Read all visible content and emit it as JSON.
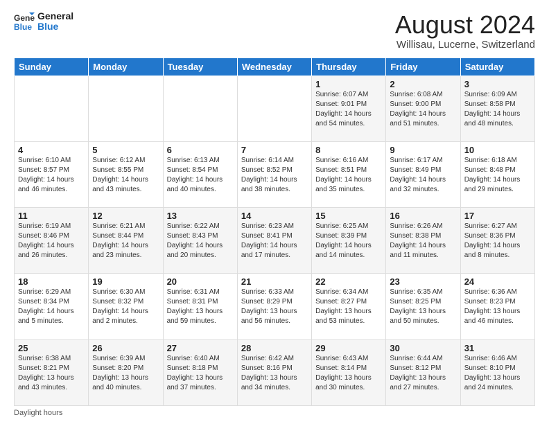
{
  "logo": {
    "line1": "General",
    "line2": "Blue"
  },
  "header": {
    "month": "August 2024",
    "location": "Willisau, Lucerne, Switzerland"
  },
  "weekdays": [
    "Sunday",
    "Monday",
    "Tuesday",
    "Wednesday",
    "Thursday",
    "Friday",
    "Saturday"
  ],
  "footer": "Daylight hours",
  "weeks": [
    [
      {
        "day": "",
        "info": ""
      },
      {
        "day": "",
        "info": ""
      },
      {
        "day": "",
        "info": ""
      },
      {
        "day": "",
        "info": ""
      },
      {
        "day": "1",
        "info": "Sunrise: 6:07 AM\nSunset: 9:01 PM\nDaylight: 14 hours\nand 54 minutes."
      },
      {
        "day": "2",
        "info": "Sunrise: 6:08 AM\nSunset: 9:00 PM\nDaylight: 14 hours\nand 51 minutes."
      },
      {
        "day": "3",
        "info": "Sunrise: 6:09 AM\nSunset: 8:58 PM\nDaylight: 14 hours\nand 48 minutes."
      }
    ],
    [
      {
        "day": "4",
        "info": "Sunrise: 6:10 AM\nSunset: 8:57 PM\nDaylight: 14 hours\nand 46 minutes."
      },
      {
        "day": "5",
        "info": "Sunrise: 6:12 AM\nSunset: 8:55 PM\nDaylight: 14 hours\nand 43 minutes."
      },
      {
        "day": "6",
        "info": "Sunrise: 6:13 AM\nSunset: 8:54 PM\nDaylight: 14 hours\nand 40 minutes."
      },
      {
        "day": "7",
        "info": "Sunrise: 6:14 AM\nSunset: 8:52 PM\nDaylight: 14 hours\nand 38 minutes."
      },
      {
        "day": "8",
        "info": "Sunrise: 6:16 AM\nSunset: 8:51 PM\nDaylight: 14 hours\nand 35 minutes."
      },
      {
        "day": "9",
        "info": "Sunrise: 6:17 AM\nSunset: 8:49 PM\nDaylight: 14 hours\nand 32 minutes."
      },
      {
        "day": "10",
        "info": "Sunrise: 6:18 AM\nSunset: 8:48 PM\nDaylight: 14 hours\nand 29 minutes."
      }
    ],
    [
      {
        "day": "11",
        "info": "Sunrise: 6:19 AM\nSunset: 8:46 PM\nDaylight: 14 hours\nand 26 minutes."
      },
      {
        "day": "12",
        "info": "Sunrise: 6:21 AM\nSunset: 8:44 PM\nDaylight: 14 hours\nand 23 minutes."
      },
      {
        "day": "13",
        "info": "Sunrise: 6:22 AM\nSunset: 8:43 PM\nDaylight: 14 hours\nand 20 minutes."
      },
      {
        "day": "14",
        "info": "Sunrise: 6:23 AM\nSunset: 8:41 PM\nDaylight: 14 hours\nand 17 minutes."
      },
      {
        "day": "15",
        "info": "Sunrise: 6:25 AM\nSunset: 8:39 PM\nDaylight: 14 hours\nand 14 minutes."
      },
      {
        "day": "16",
        "info": "Sunrise: 6:26 AM\nSunset: 8:38 PM\nDaylight: 14 hours\nand 11 minutes."
      },
      {
        "day": "17",
        "info": "Sunrise: 6:27 AM\nSunset: 8:36 PM\nDaylight: 14 hours\nand 8 minutes."
      }
    ],
    [
      {
        "day": "18",
        "info": "Sunrise: 6:29 AM\nSunset: 8:34 PM\nDaylight: 14 hours\nand 5 minutes."
      },
      {
        "day": "19",
        "info": "Sunrise: 6:30 AM\nSunset: 8:32 PM\nDaylight: 14 hours\nand 2 minutes."
      },
      {
        "day": "20",
        "info": "Sunrise: 6:31 AM\nSunset: 8:31 PM\nDaylight: 13 hours\nand 59 minutes."
      },
      {
        "day": "21",
        "info": "Sunrise: 6:33 AM\nSunset: 8:29 PM\nDaylight: 13 hours\nand 56 minutes."
      },
      {
        "day": "22",
        "info": "Sunrise: 6:34 AM\nSunset: 8:27 PM\nDaylight: 13 hours\nand 53 minutes."
      },
      {
        "day": "23",
        "info": "Sunrise: 6:35 AM\nSunset: 8:25 PM\nDaylight: 13 hours\nand 50 minutes."
      },
      {
        "day": "24",
        "info": "Sunrise: 6:36 AM\nSunset: 8:23 PM\nDaylight: 13 hours\nand 46 minutes."
      }
    ],
    [
      {
        "day": "25",
        "info": "Sunrise: 6:38 AM\nSunset: 8:21 PM\nDaylight: 13 hours\nand 43 minutes."
      },
      {
        "day": "26",
        "info": "Sunrise: 6:39 AM\nSunset: 8:20 PM\nDaylight: 13 hours\nand 40 minutes."
      },
      {
        "day": "27",
        "info": "Sunrise: 6:40 AM\nSunset: 8:18 PM\nDaylight: 13 hours\nand 37 minutes."
      },
      {
        "day": "28",
        "info": "Sunrise: 6:42 AM\nSunset: 8:16 PM\nDaylight: 13 hours\nand 34 minutes."
      },
      {
        "day": "29",
        "info": "Sunrise: 6:43 AM\nSunset: 8:14 PM\nDaylight: 13 hours\nand 30 minutes."
      },
      {
        "day": "30",
        "info": "Sunrise: 6:44 AM\nSunset: 8:12 PM\nDaylight: 13 hours\nand 27 minutes."
      },
      {
        "day": "31",
        "info": "Sunrise: 6:46 AM\nSunset: 8:10 PM\nDaylight: 13 hours\nand 24 minutes."
      }
    ]
  ]
}
